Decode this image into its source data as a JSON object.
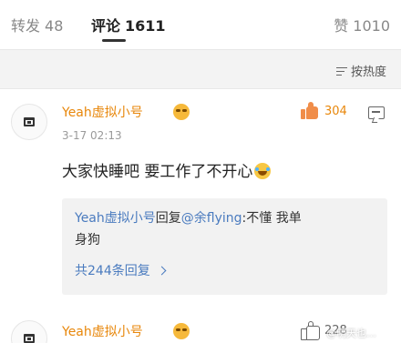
{
  "tabs": {
    "repost": {
      "label": "转发",
      "count": "48"
    },
    "comment": {
      "label": "评论",
      "count": "1611"
    },
    "like": {
      "label": "赞",
      "count": "1010"
    }
  },
  "sort": {
    "label": "按热度"
  },
  "comments": [
    {
      "username": "Yeah虚拟小号",
      "like_count": "304",
      "timestamp": "3-17 02:13",
      "text": "大家快睡吧 要工作了不开心",
      "reply": {
        "user": "Yeah虚拟小号",
        "verb": "回复",
        "mention": "@余flying",
        "text_line1": ":不懂 我单",
        "text_line2": "身狗",
        "more": "共244条回复"
      }
    },
    {
      "username": "Yeah虚拟小号",
      "like_count": "228"
    }
  ],
  "watermark": "@明天也…"
}
